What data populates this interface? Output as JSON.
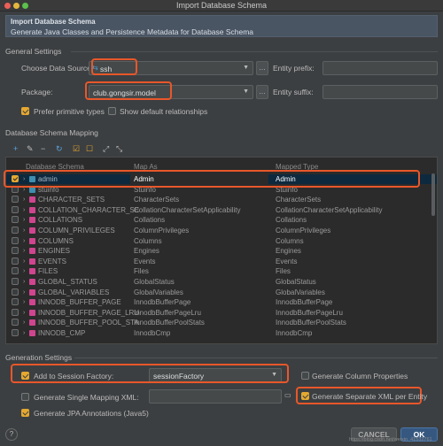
{
  "window": {
    "title": "Import Database Schema"
  },
  "header": {
    "title": "Import Database Schema",
    "subtitle": "Generate Java Classes and Persistence Metadata for Database Schema"
  },
  "general": {
    "section_label": "General Settings",
    "data_source_label": "Choose Data Source:",
    "data_source_value": "ssh",
    "entity_prefix_label": "Entity prefix:",
    "package_label": "Package:",
    "package_value": "club.gongsir.model",
    "entity_suffix_label": "Entity suffix:",
    "prefer_primitive_label": "Prefer primitive types",
    "prefer_primitive_checked": true,
    "show_default_rel_label": "Show default relationships",
    "show_default_rel_checked": false
  },
  "mapping": {
    "section_label": "Database Schema Mapping",
    "columns": [
      "Database Schema",
      "Map As",
      "Mapped Type"
    ],
    "rows": [
      {
        "name": "admin",
        "map": "Admin",
        "type": "Admin",
        "checked": true,
        "selected": true,
        "kind": "table"
      },
      {
        "name": "stuinfo",
        "map": "Stuinfo",
        "type": "Stuinfo",
        "checked": false,
        "selected": false,
        "kind": "table"
      },
      {
        "name": "CHARACTER_SETS",
        "map": "CharacterSets",
        "type": "CharacterSets",
        "checked": false,
        "selected": false,
        "kind": "view"
      },
      {
        "name": "COLLATION_CHARACTER_SE",
        "map": "CollationCharacterSetApplicability",
        "type": "CollationCharacterSetApplicability",
        "checked": false,
        "selected": false,
        "kind": "view"
      },
      {
        "name": "COLLATIONS",
        "map": "Collations",
        "type": "Collations",
        "checked": false,
        "selected": false,
        "kind": "view"
      },
      {
        "name": "COLUMN_PRIVILEGES",
        "map": "ColumnPrivileges",
        "type": "ColumnPrivileges",
        "checked": false,
        "selected": false,
        "kind": "view"
      },
      {
        "name": "COLUMNS",
        "map": "Columns",
        "type": "Columns",
        "checked": false,
        "selected": false,
        "kind": "view"
      },
      {
        "name": "ENGINES",
        "map": "Engines",
        "type": "Engines",
        "checked": false,
        "selected": false,
        "kind": "view"
      },
      {
        "name": "EVENTS",
        "map": "Events",
        "type": "Events",
        "checked": false,
        "selected": false,
        "kind": "view"
      },
      {
        "name": "FILES",
        "map": "Files",
        "type": "Files",
        "checked": false,
        "selected": false,
        "kind": "view"
      },
      {
        "name": "GLOBAL_STATUS",
        "map": "GlobalStatus",
        "type": "GlobalStatus",
        "checked": false,
        "selected": false,
        "kind": "view"
      },
      {
        "name": "GLOBAL_VARIABLES",
        "map": "GlobalVariables",
        "type": "GlobalVariables",
        "checked": false,
        "selected": false,
        "kind": "view"
      },
      {
        "name": "INNODB_BUFFER_PAGE",
        "map": "InnodbBufferPage",
        "type": "InnodbBufferPage",
        "checked": false,
        "selected": false,
        "kind": "view"
      },
      {
        "name": "INNODB_BUFFER_PAGE_LRU",
        "map": "InnodbBufferPageLru",
        "type": "InnodbBufferPageLru",
        "checked": false,
        "selected": false,
        "kind": "view"
      },
      {
        "name": "INNODB_BUFFER_POOL_STA",
        "map": "InnodbBufferPoolStats",
        "type": "InnodbBufferPoolStats",
        "checked": false,
        "selected": false,
        "kind": "view"
      },
      {
        "name": "INNODB_CMP",
        "map": "InnodbCmp",
        "type": "InnodbCmp",
        "checked": false,
        "selected": false,
        "kind": "view"
      }
    ]
  },
  "generation": {
    "section_label": "Generation Settings",
    "session_factory_label": "Add to Session Factory:",
    "session_factory_checked": true,
    "session_factory_value": "sessionFactory",
    "column_props_label": "Generate Column Properties",
    "column_props_checked": false,
    "single_mapping_label": "Generate Single Mapping XML:",
    "single_mapping_checked": false,
    "separate_xml_label": "Generate Separate XML per Entity",
    "separate_xml_checked": true,
    "jpa_label": "Generate JPA Annotations (Java5)",
    "jpa_checked": true
  },
  "footer": {
    "help": "?",
    "cancel_label": "CANCEL",
    "ok_label": "OK",
    "watermark": "https://blog.csdn.net/weixin_41532761"
  },
  "colors": {
    "highlight": "#e8572a",
    "checkbox_on": "#e5a830",
    "selection": "#0d293e",
    "ok_button": "#365880"
  }
}
